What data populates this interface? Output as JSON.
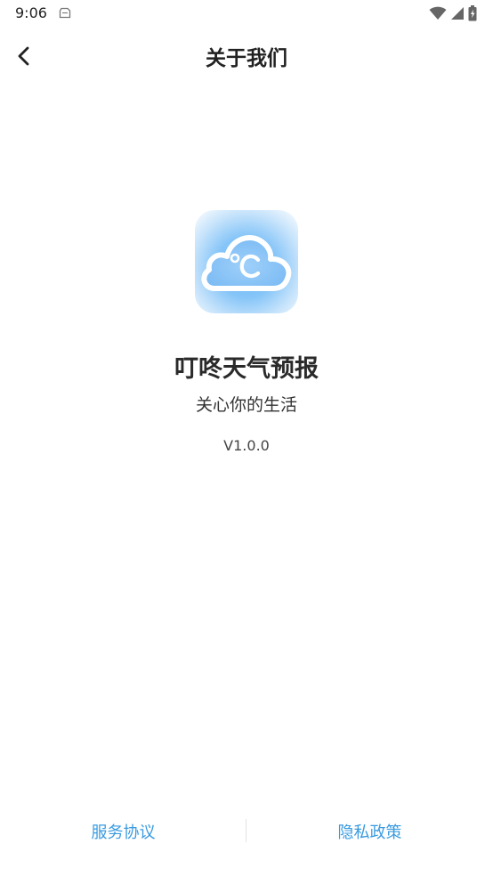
{
  "status_bar": {
    "time": "9:06",
    "icons": [
      "sim-card-icon",
      "wifi-icon",
      "cellular-signal-icon",
      "battery-charging-icon"
    ]
  },
  "header": {
    "back_icon": "chevron-left-icon",
    "title": "关于我们"
  },
  "app": {
    "icon": "cloud-celsius-icon",
    "icon_colors": {
      "background": "#86c5f8",
      "cloud": "#ffffff"
    },
    "name": "叮咚天气预报",
    "slogan": "关心你的生活",
    "version": "V1.0.0"
  },
  "footer": {
    "service_agreement": "服务协议",
    "privacy_policy": "隐私政策",
    "link_color": "#3a9be0"
  }
}
